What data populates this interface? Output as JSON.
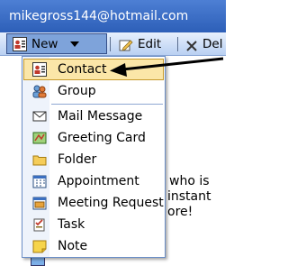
{
  "window": {
    "account_email": "mikegross144@hotmail.com"
  },
  "toolbar": {
    "new_label": "New",
    "edit_label": "Edit",
    "delete_label": "Del"
  },
  "new_menu": {
    "items": [
      {
        "label": "Contact",
        "icon": "contact-card-icon",
        "highlighted": true
      },
      {
        "label": "Group",
        "icon": "group-icon"
      },
      {
        "label": "Mail Message",
        "icon": "mail-message-icon"
      },
      {
        "label": "Greeting Card",
        "icon": "greeting-card-icon"
      },
      {
        "label": "Folder",
        "icon": "folder-icon"
      },
      {
        "label": "Appointment",
        "icon": "appointment-icon"
      },
      {
        "label": "Meeting Request",
        "icon": "meeting-request-icon"
      },
      {
        "label": "Task",
        "icon": "task-icon"
      },
      {
        "label": "Note",
        "icon": "note-icon"
      }
    ]
  },
  "background_text": {
    "line1": "who is",
    "line2": "instant",
    "line3": "ore!"
  },
  "colors": {
    "titlebar": "#2d5fb8",
    "highlight": "#fbe6a8",
    "arrow": "#000000"
  }
}
